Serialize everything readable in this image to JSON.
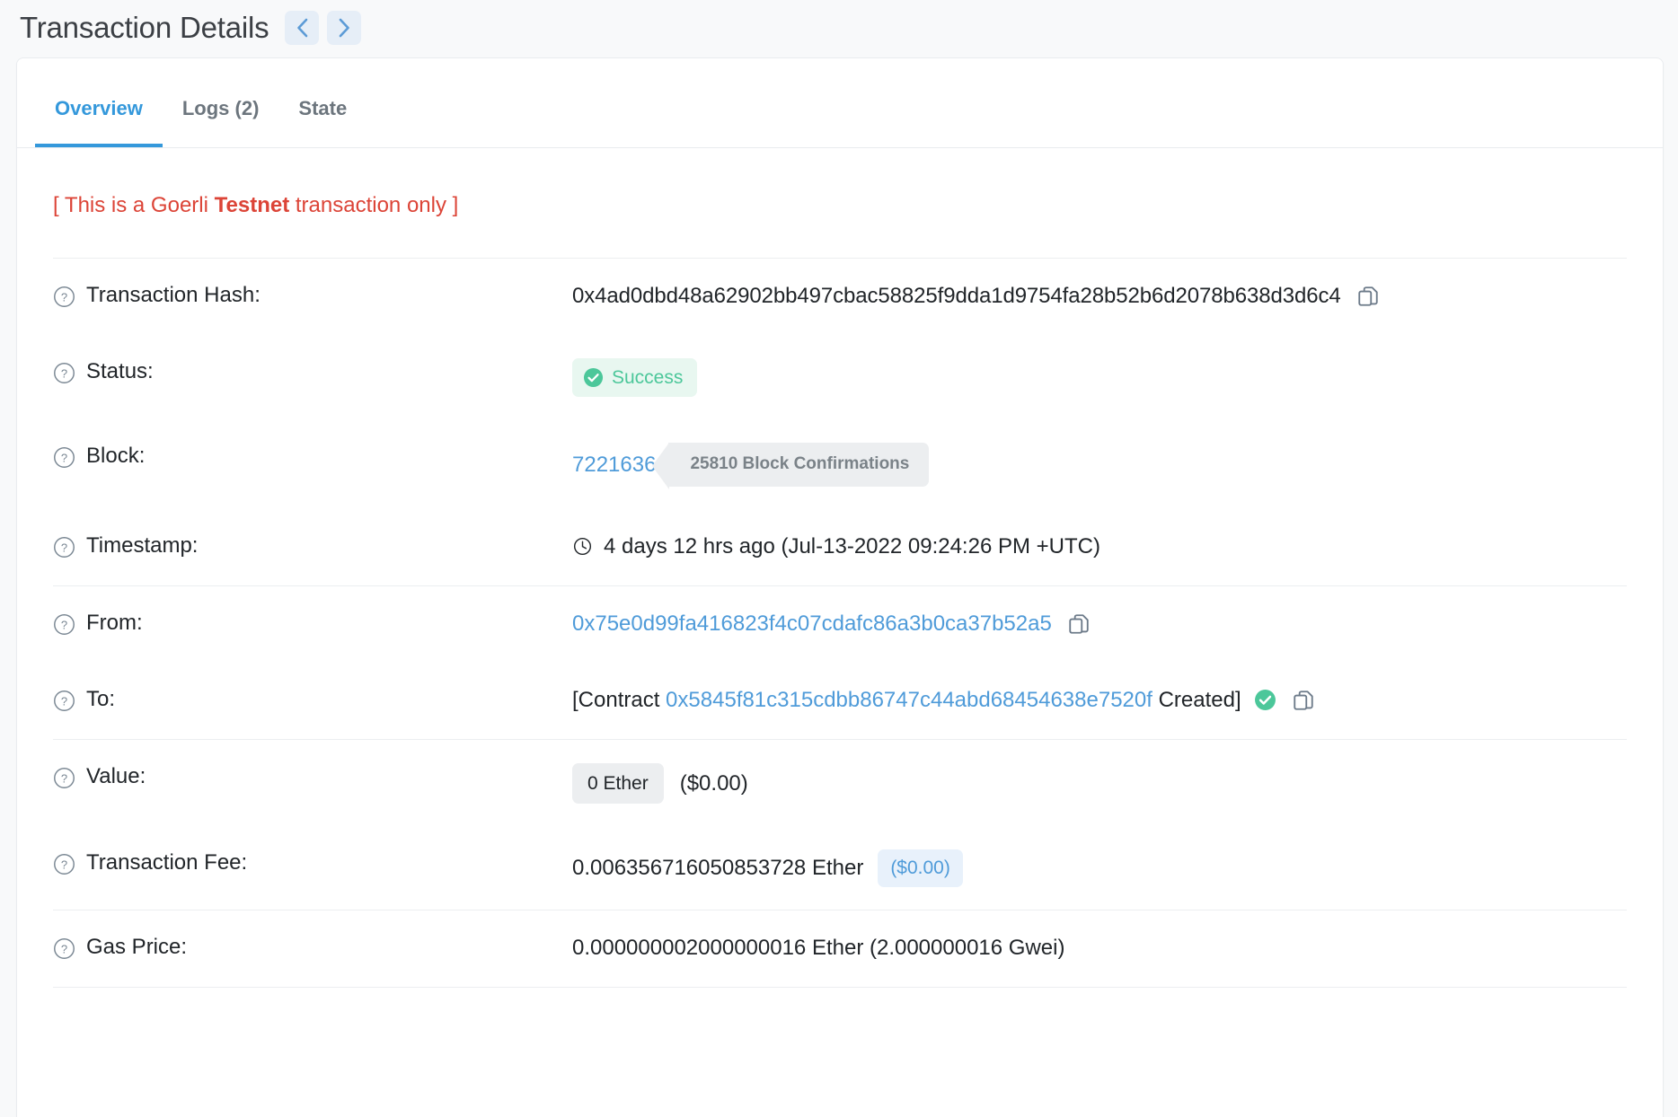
{
  "header": {
    "title": "Transaction Details",
    "prev_button": "‹",
    "next_button": "›"
  },
  "tabs": [
    {
      "label": "Overview",
      "active": true
    },
    {
      "label": "Logs (2)",
      "active": false
    },
    {
      "label": "State",
      "active": false
    }
  ],
  "notice": {
    "prefix": "[ This is a Goerli ",
    "emphasis": "Testnet",
    "suffix": " transaction only ]"
  },
  "rows": {
    "transaction_hash": {
      "label": "Transaction Hash:",
      "value": "0x4ad0dbd48a62902bb497cbac58825f9dda1d9754fa28b52b6d2078b638d3d6c4"
    },
    "status": {
      "label": "Status:",
      "value": "Success"
    },
    "block": {
      "label": "Block:",
      "number": "7221636",
      "confirmations": "25810 Block Confirmations"
    },
    "timestamp": {
      "label": "Timestamp:",
      "value": "4 days 12 hrs ago (Jul-13-2022 09:24:26 PM +UTC)"
    },
    "from": {
      "label": "From:",
      "value": "0x75e0d99fa416823f4c07cdafc86a3b0ca37b52a5"
    },
    "to": {
      "label": "To:",
      "prefix": "[Contract",
      "address": "0x5845f81c315cdbb86747c44abd68454638e7520f",
      "suffix": "Created]"
    },
    "value": {
      "label": "Value:",
      "amount": "0 Ether",
      "usd": "($0.00)"
    },
    "transaction_fee": {
      "label": "Transaction Fee:",
      "amount": "0.006356716050853728 Ether",
      "usd": "($0.00)"
    },
    "gas_price": {
      "label": "Gas Price:",
      "value": "0.000000002000000016 Ether (2.000000016 Gwei)"
    }
  },
  "icons": {
    "help": "question-circle-icon",
    "copy": "copy-icon",
    "clock": "clock-icon",
    "check": "check-circle-icon"
  },
  "colors": {
    "accent": "#3498db",
    "link": "#4f9bd9",
    "success": "#4cc79a",
    "warning": "#dc4437",
    "text": "#212529",
    "muted": "#6c757d"
  }
}
